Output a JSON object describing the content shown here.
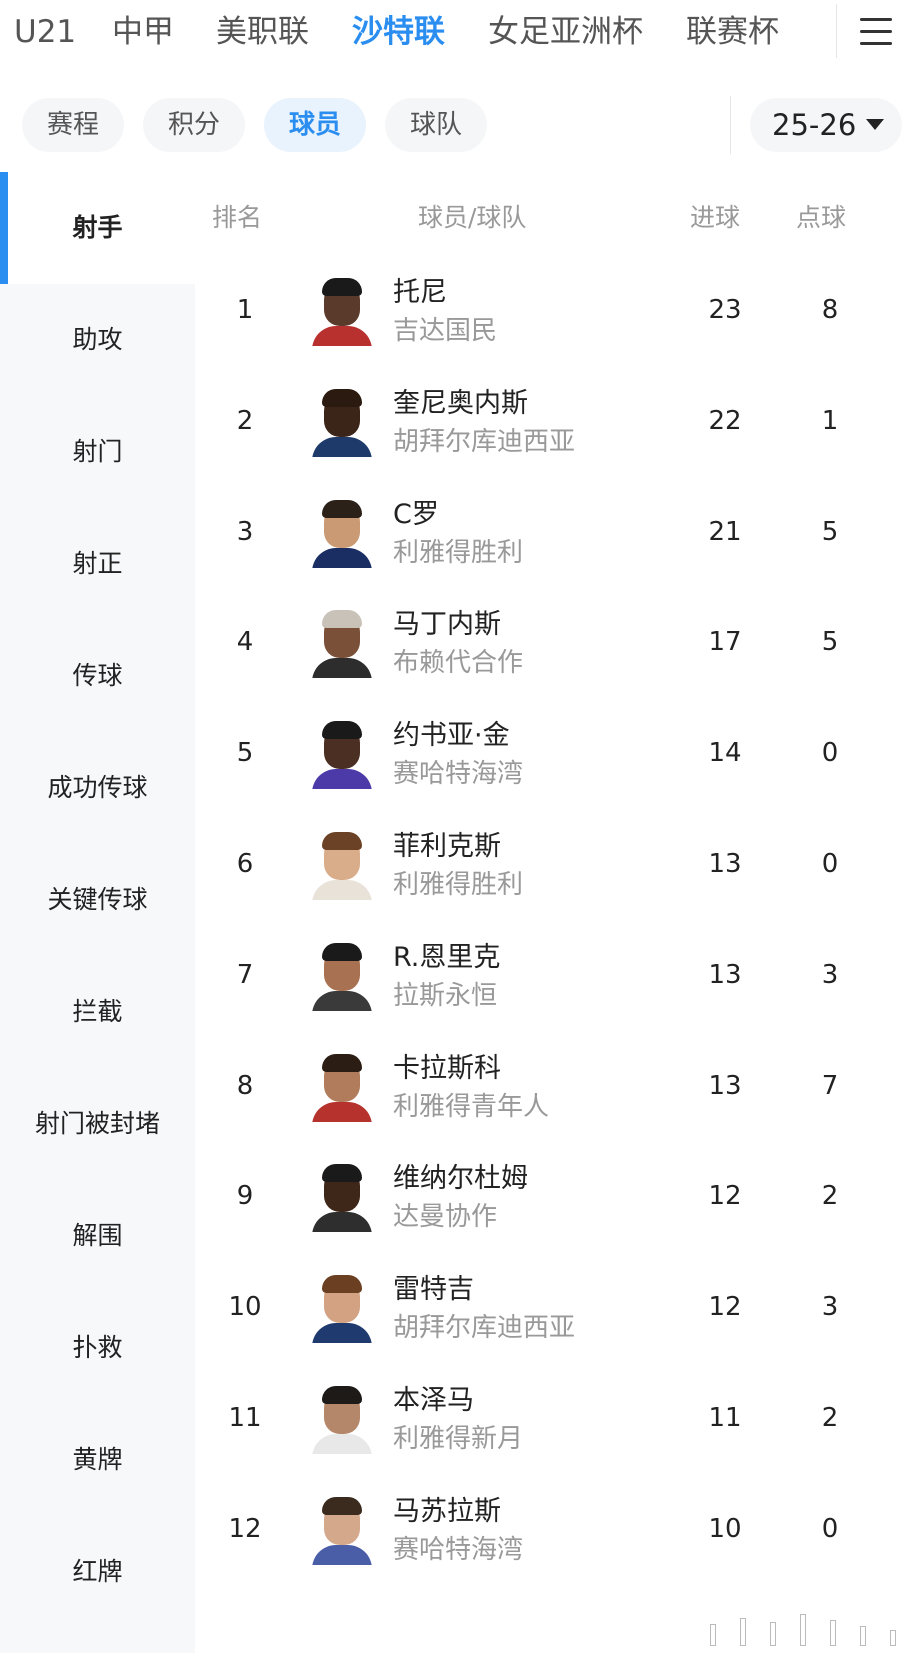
{
  "league_tabs": [
    {
      "label": "U21",
      "active": false
    },
    {
      "label": "中甲",
      "active": false
    },
    {
      "label": "美职联",
      "active": false
    },
    {
      "label": "沙特联",
      "active": true
    },
    {
      "label": "女足亚洲杯",
      "active": false
    },
    {
      "label": "联赛杯",
      "active": false
    }
  ],
  "menu_icon": "hamburger-menu-icon",
  "sub_tabs": [
    {
      "label": "赛程",
      "active": false
    },
    {
      "label": "积分",
      "active": false
    },
    {
      "label": "球员",
      "active": true
    },
    {
      "label": "球队",
      "active": false
    }
  ],
  "season": {
    "value": "25-26",
    "icon": "caret-down-icon"
  },
  "categories": [
    {
      "label": "射手",
      "active": true
    },
    {
      "label": "助攻",
      "active": false
    },
    {
      "label": "射门",
      "active": false
    },
    {
      "label": "射正",
      "active": false
    },
    {
      "label": "传球",
      "active": false
    },
    {
      "label": "成功传球",
      "active": false
    },
    {
      "label": "关键传球",
      "active": false
    },
    {
      "label": "拦截",
      "active": false
    },
    {
      "label": "射门被封堵",
      "active": false
    },
    {
      "label": "解围",
      "active": false
    },
    {
      "label": "扑救",
      "active": false
    },
    {
      "label": "黄牌",
      "active": false
    },
    {
      "label": "红牌",
      "active": false
    }
  ],
  "table": {
    "headers": {
      "rank": "排名",
      "player_team": "球员/球队",
      "goals": "进球",
      "penalties": "点球"
    },
    "rows": [
      {
        "rank": "1",
        "name": "托尼",
        "team": "吉达国民",
        "goals": "23",
        "penalties": "8",
        "skin": "#5a3a2a",
        "hair": "#1a1a1a",
        "kit": "#b8312f"
      },
      {
        "rank": "2",
        "name": "奎尼奥内斯",
        "team": "胡拜尔库迪西亚",
        "goals": "22",
        "penalties": "1",
        "skin": "#3b2418",
        "hair": "#2a1a10",
        "kit": "#1d3a6b"
      },
      {
        "rank": "3",
        "name": "C罗",
        "team": "利雅得胜利",
        "goals": "21",
        "penalties": "5",
        "skin": "#c99a74",
        "hair": "#2b2118",
        "kit": "#1a2e63"
      },
      {
        "rank": "4",
        "name": "马丁内斯",
        "team": "布赖代合作",
        "goals": "17",
        "penalties": "5",
        "skin": "#7a5038",
        "hair": "#c9c2b8",
        "kit": "#2d2d2d"
      },
      {
        "rank": "5",
        "name": "约书亚·金",
        "team": "赛哈特海湾",
        "goals": "14",
        "penalties": "0",
        "skin": "#4a2f22",
        "hair": "#1a1a1a",
        "kit": "#4b3aa8"
      },
      {
        "rank": "6",
        "name": "菲利克斯",
        "team": "利雅得胜利",
        "goals": "13",
        "penalties": "0",
        "skin": "#d9ad8a",
        "hair": "#6b4226",
        "kit": "#e8e2d8"
      },
      {
        "rank": "7",
        "name": "R.恩里克",
        "team": "拉斯永恒",
        "goals": "13",
        "penalties": "3",
        "skin": "#a87252",
        "hair": "#1a1a1a",
        "kit": "#3a3a3a"
      },
      {
        "rank": "8",
        "name": "卡拉斯科",
        "team": "利雅得青年人",
        "goals": "13",
        "penalties": "7",
        "skin": "#b07c5c",
        "hair": "#2b1d14",
        "kit": "#b5332c"
      },
      {
        "rank": "9",
        "name": "维纳尔杜姆",
        "team": "达曼协作",
        "goals": "12",
        "penalties": "2",
        "skin": "#3e2619",
        "hair": "#1a1a1a",
        "kit": "#2e2e2e"
      },
      {
        "rank": "10",
        "name": "雷特吉",
        "team": "胡拜尔库迪西亚",
        "goals": "12",
        "penalties": "3",
        "skin": "#d2a283",
        "hair": "#6a3f22",
        "kit": "#1e3a6e"
      },
      {
        "rank": "11",
        "name": "本泽马",
        "team": "利雅得新月",
        "goals": "11",
        "penalties": "2",
        "skin": "#b5876a",
        "hair": "#1e1a18",
        "kit": "#e8e8e8"
      },
      {
        "rank": "12",
        "name": "马苏拉斯",
        "team": "赛哈特海湾",
        "goals": "10",
        "penalties": "0",
        "skin": "#d4a88a",
        "hair": "#3a2b1e",
        "kit": "#4a5ea8"
      }
    ]
  }
}
